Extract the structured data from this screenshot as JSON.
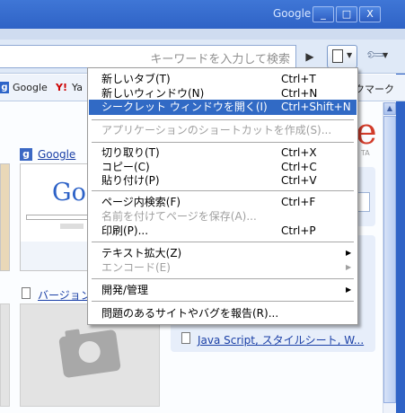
{
  "window": {
    "title": "Google",
    "buttons": [
      "_",
      "□",
      "X"
    ]
  },
  "toolbar": {
    "search_placeholder": "キーワードを入力して検索",
    "go_icon": "▶",
    "page_menu_icon": "page-icon",
    "tools_menu_icon": "wrench-icon",
    "dropdown_glyph": "▼"
  },
  "bookmarks": [
    {
      "icon": "g",
      "label": "Google"
    },
    {
      "icon": "Y!",
      "label": "Ya"
    },
    {
      "label": "クマーク"
    }
  ],
  "content": {
    "brand_fragment": "e",
    "brand_sub": "TA",
    "thumb1": {
      "icon": "g",
      "title": "Google",
      "logo_text": "Goo"
    },
    "version_link": "バージョン",
    "js_link": "Java Script, スタイルシート, W..."
  },
  "menu": {
    "items": [
      {
        "label": "新しいタブ(T)",
        "shortcut": "Ctrl+T",
        "state": "normal"
      },
      {
        "label": "新しいウィンドウ(N)",
        "shortcut": "Ctrl+N",
        "state": "normal"
      },
      {
        "label": "シークレット ウィンドウを開く(I)",
        "shortcut": "Ctrl+Shift+N",
        "state": "selected"
      },
      {
        "label": "アプリケーションのショートカットを作成(S)...",
        "shortcut": "",
        "state": "disabled"
      },
      {
        "label": "切り取り(T)",
        "shortcut": "Ctrl+X",
        "state": "normal"
      },
      {
        "label": "コピー(C)",
        "shortcut": "Ctrl+C",
        "state": "normal"
      },
      {
        "label": "貼り付け(P)",
        "shortcut": "Ctrl+V",
        "state": "normal"
      },
      {
        "label": "ページ内検索(F)",
        "shortcut": "Ctrl+F",
        "state": "normal"
      },
      {
        "label": "名前を付けてページを保存(A)...",
        "shortcut": "",
        "state": "disabled"
      },
      {
        "label": "印刷(P)...",
        "shortcut": "Ctrl+P",
        "state": "normal"
      },
      {
        "label": "テキスト拡大(Z)",
        "shortcut": "",
        "state": "normal",
        "submenu": true
      },
      {
        "label": "エンコード(E)",
        "shortcut": "",
        "state": "disabled",
        "submenu": true
      },
      {
        "label": "開発/管理",
        "shortcut": "",
        "state": "normal",
        "submenu": true
      },
      {
        "label": "問題のあるサイトやバグを報告(R)...",
        "shortcut": "",
        "state": "normal"
      }
    ],
    "submenu_arrow": "▶"
  },
  "colors": {
    "titlebar": "#2f63c6",
    "menu_highlight": "#316ac5",
    "link": "#1a3fa6",
    "disabled_text": "#a0a0a0"
  }
}
